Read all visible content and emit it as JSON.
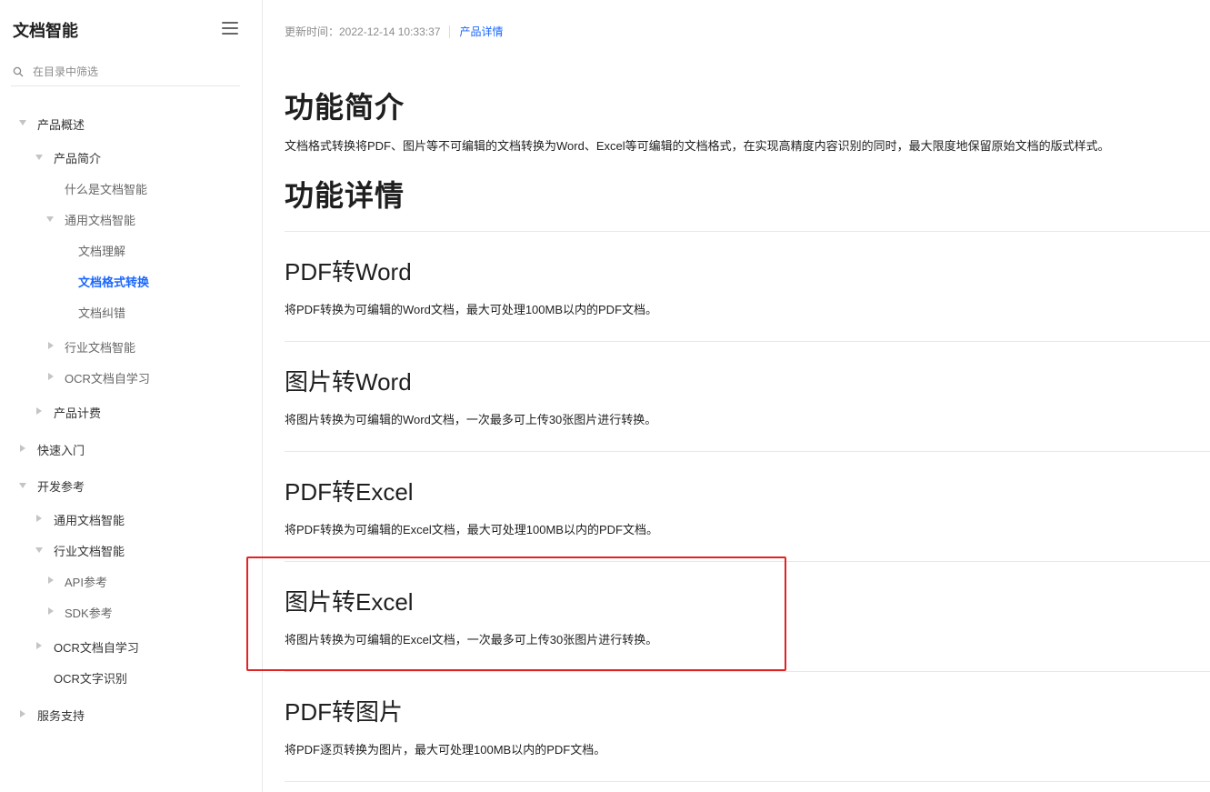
{
  "sidebar": {
    "title": "文档智能",
    "menu_icon": "hamburger-menu-icon",
    "filter_placeholder": "在目录中筛选",
    "items": [
      {
        "label": "产品概述"
      },
      {
        "label": "产品简介"
      },
      {
        "label": "什么是文档智能"
      },
      {
        "label": "通用文档智能"
      },
      {
        "label": "文档理解"
      },
      {
        "label": "文档格式转换",
        "active": true
      },
      {
        "label": "文档纠错"
      },
      {
        "label": "行业文档智能"
      },
      {
        "label": "OCR文档自学习"
      },
      {
        "label": "产品计费"
      },
      {
        "label": "快速入门"
      },
      {
        "label": "开发参考"
      },
      {
        "label": "通用文档智能"
      },
      {
        "label": "行业文档智能"
      },
      {
        "label": "API参考"
      },
      {
        "label": "SDK参考"
      },
      {
        "label": "OCR文档自学习"
      },
      {
        "label": "OCR文字识别"
      },
      {
        "label": "服务支持"
      }
    ]
  },
  "meta": {
    "updated": "更新时间：2022-12-14 10:33:37",
    "link": "产品详情"
  },
  "main": {
    "intro_title": "功能简介",
    "intro_text": "文档格式转换将PDF、图片等不可编辑的文档转换为Word、Excel等可编辑的文档格式，在实现高精度内容识别的同时，最大限度地保留原始文档的版式样式。",
    "details_title": "功能详情",
    "sections": [
      {
        "title": "PDF转Word",
        "desc": "将PDF转换为可编辑的Word文档，最大可处理100MB以内的PDF文档。"
      },
      {
        "title": "图片转Word",
        "desc": "将图片转换为可编辑的Word文档，一次最多可上传30张图片进行转换。"
      },
      {
        "title": "PDF转Excel",
        "desc": "将PDF转换为可编辑的Excel文档，最大可处理100MB以内的PDF文档。"
      },
      {
        "title": "图片转Excel",
        "desc": "将图片转换为可编辑的Excel文档，一次最多可上传30张图片进行转换。"
      },
      {
        "title": "PDF转图片",
        "desc": "将PDF逐页转换为图片，最大可处理100MB以内的PDF文档。"
      }
    ]
  },
  "colors": {
    "accent": "#1a66ff",
    "highlight": "#e02424"
  }
}
